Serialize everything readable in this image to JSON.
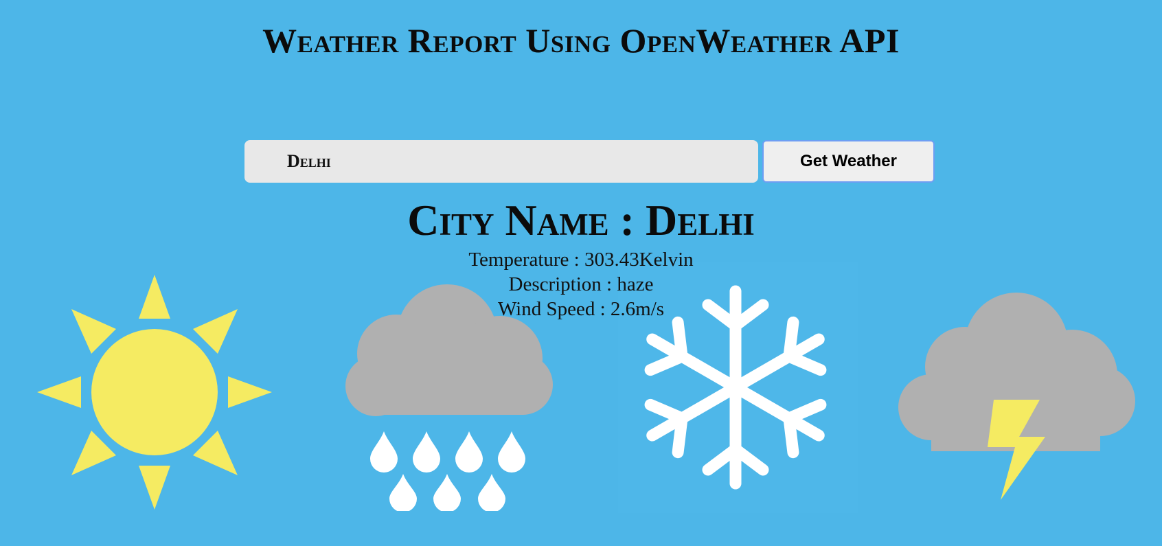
{
  "header": {
    "title": "Weather Report Using OpenWeather API"
  },
  "search": {
    "value": "Delhi",
    "button_label": "Get Weather"
  },
  "result": {
    "city_line": "City Name : Delhi",
    "temperature_line": "Temperature : 303.43Kelvin",
    "description_line": "Description : haze",
    "wind_line": "Wind Speed : 2.6m/s"
  },
  "colors": {
    "background": "#4db6e8",
    "sun": "#f5eb62",
    "cloud": "#b0b0b0",
    "snow": "#ffffff",
    "button_border": "#6d9ef3"
  },
  "icons": [
    "sun-icon",
    "rain-cloud-icon",
    "snowflake-icon",
    "thunderstorm-cloud-icon"
  ]
}
